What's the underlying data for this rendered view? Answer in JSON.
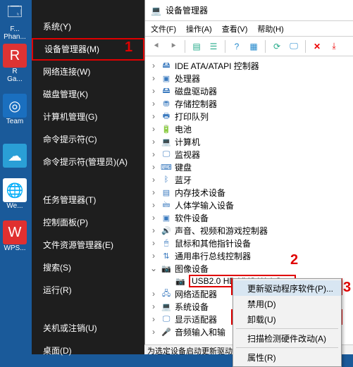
{
  "desktop": {
    "items": [
      {
        "label": "F...",
        "sub": "Phan..."
      },
      {
        "label": "R",
        "sub": "Ga..."
      },
      {
        "label": "",
        "sub": ""
      },
      {
        "label": "",
        "sub": "Team"
      },
      {
        "label": "",
        "sub": ""
      },
      {
        "label": "",
        "sub": "We..."
      },
      {
        "label": "",
        "sub": ""
      },
      {
        "label": "",
        "sub": "WPS..."
      }
    ]
  },
  "start_menu": {
    "items": [
      "系统(Y)",
      "设备管理器(M)",
      "网络连接(W)",
      "磁盘管理(K)",
      "计算机管理(G)",
      "命令提示符(C)",
      "命令提示符(管理员)(A)",
      "任务管理器(T)",
      "控制面板(P)",
      "文件资源管理器(E)",
      "搜索(S)",
      "运行(R)",
      "关机或注销(U)",
      "桌面(D)"
    ],
    "highlight_index": 1
  },
  "devmgr": {
    "title": "设备管理器",
    "menu": [
      "文件(F)",
      "操作(A)",
      "查看(V)",
      "帮助(H)"
    ],
    "tree": [
      {
        "label": "IDE ATA/ATAPI 控制器",
        "icon": "🖴"
      },
      {
        "label": "处理器",
        "icon": "▣"
      },
      {
        "label": "磁盘驱动器",
        "icon": "🖴"
      },
      {
        "label": "存储控制器",
        "icon": "⛃"
      },
      {
        "label": "打印队列",
        "icon": "🖶"
      },
      {
        "label": "电池",
        "icon": "🔋"
      },
      {
        "label": "计算机",
        "icon": "💻"
      },
      {
        "label": "监视器",
        "icon": "🖵"
      },
      {
        "label": "键盘",
        "icon": "⌨"
      },
      {
        "label": "蓝牙",
        "icon": "ᛒ"
      },
      {
        "label": "内存技术设备",
        "icon": "▤"
      },
      {
        "label": "人体学输入设备",
        "icon": "🖮"
      },
      {
        "label": "软件设备",
        "icon": "▣"
      },
      {
        "label": "声音、视频和游戏控制器",
        "icon": "🔊"
      },
      {
        "label": "鼠标和其他指针设备",
        "icon": "🖱"
      },
      {
        "label": "通用串行总线控制器",
        "icon": "⇅"
      },
      {
        "label": "图像设备",
        "icon": "📷",
        "expanded": true
      },
      {
        "label": "USB2.0 HD UVC WebCam",
        "icon": "📷",
        "child": true,
        "selected": true
      },
      {
        "label": "网络适配器",
        "icon": "🖧"
      },
      {
        "label": "系统设备",
        "icon": "💻"
      },
      {
        "label": "显示适配器",
        "icon": "🖵"
      },
      {
        "label": "音频输入和输",
        "icon": "🎤"
      }
    ],
    "statusbar": "为选定设备启动更新驱动"
  },
  "context_menu": {
    "items": [
      "更新驱动程序软件(P)...",
      "禁用(D)",
      "卸载(U)",
      "扫描检测硬件改动(A)",
      "属性(R)"
    ]
  },
  "annotations": {
    "a1": "1",
    "a2": "2",
    "a3a": "3",
    "a3b": "3"
  }
}
